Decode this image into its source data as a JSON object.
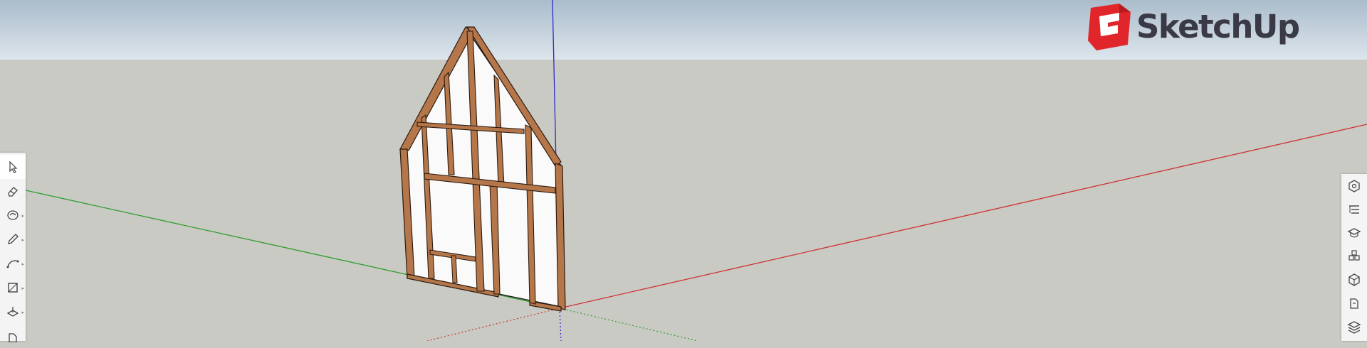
{
  "app": {
    "name": "SketchUp",
    "logo_text": "SketchUp",
    "colors": {
      "sky_top": "#aabccb",
      "sky_bottom": "#dde5ec",
      "ground": "#cacac4",
      "axis_red": "#cc3333",
      "axis_green": "#2e9e2e",
      "axis_blue": "#2a2ad0",
      "lumber": "#b5774a",
      "sheathing": "#fafafa",
      "logo_red": "#e0262b",
      "logo_text": "#3a3a46"
    }
  },
  "left_toolbar": {
    "tools": [
      {
        "name": "select",
        "icon": "select-arrow-icon",
        "selected": true,
        "has_submenu": false
      },
      {
        "name": "eraser",
        "icon": "eraser-icon",
        "selected": false,
        "has_submenu": false
      },
      {
        "name": "paint-bucket",
        "icon": "paint-bucket-icon",
        "selected": false,
        "has_submenu": true
      },
      {
        "name": "pencil",
        "icon": "pencil-icon",
        "selected": false,
        "has_submenu": true
      },
      {
        "name": "arc",
        "icon": "arc-icon",
        "selected": false,
        "has_submenu": true
      },
      {
        "name": "rectangle",
        "icon": "rectangle-icon",
        "selected": false,
        "has_submenu": true
      },
      {
        "name": "push-pull",
        "icon": "push-pull-icon",
        "selected": false,
        "has_submenu": true
      },
      {
        "name": "move",
        "icon": "move-icon",
        "selected": false,
        "has_submenu": true
      }
    ]
  },
  "right_toolbar": {
    "panels": [
      {
        "name": "entity-info",
        "icon": "entity-info-icon"
      },
      {
        "name": "outliner",
        "icon": "outliner-icon"
      },
      {
        "name": "instructor",
        "icon": "graduation-cap-icon"
      },
      {
        "name": "components",
        "icon": "components-icon"
      },
      {
        "name": "materials",
        "icon": "materials-cube-icon"
      },
      {
        "name": "styles",
        "icon": "styles-icon"
      },
      {
        "name": "layers",
        "icon": "layers-icon"
      }
    ]
  }
}
